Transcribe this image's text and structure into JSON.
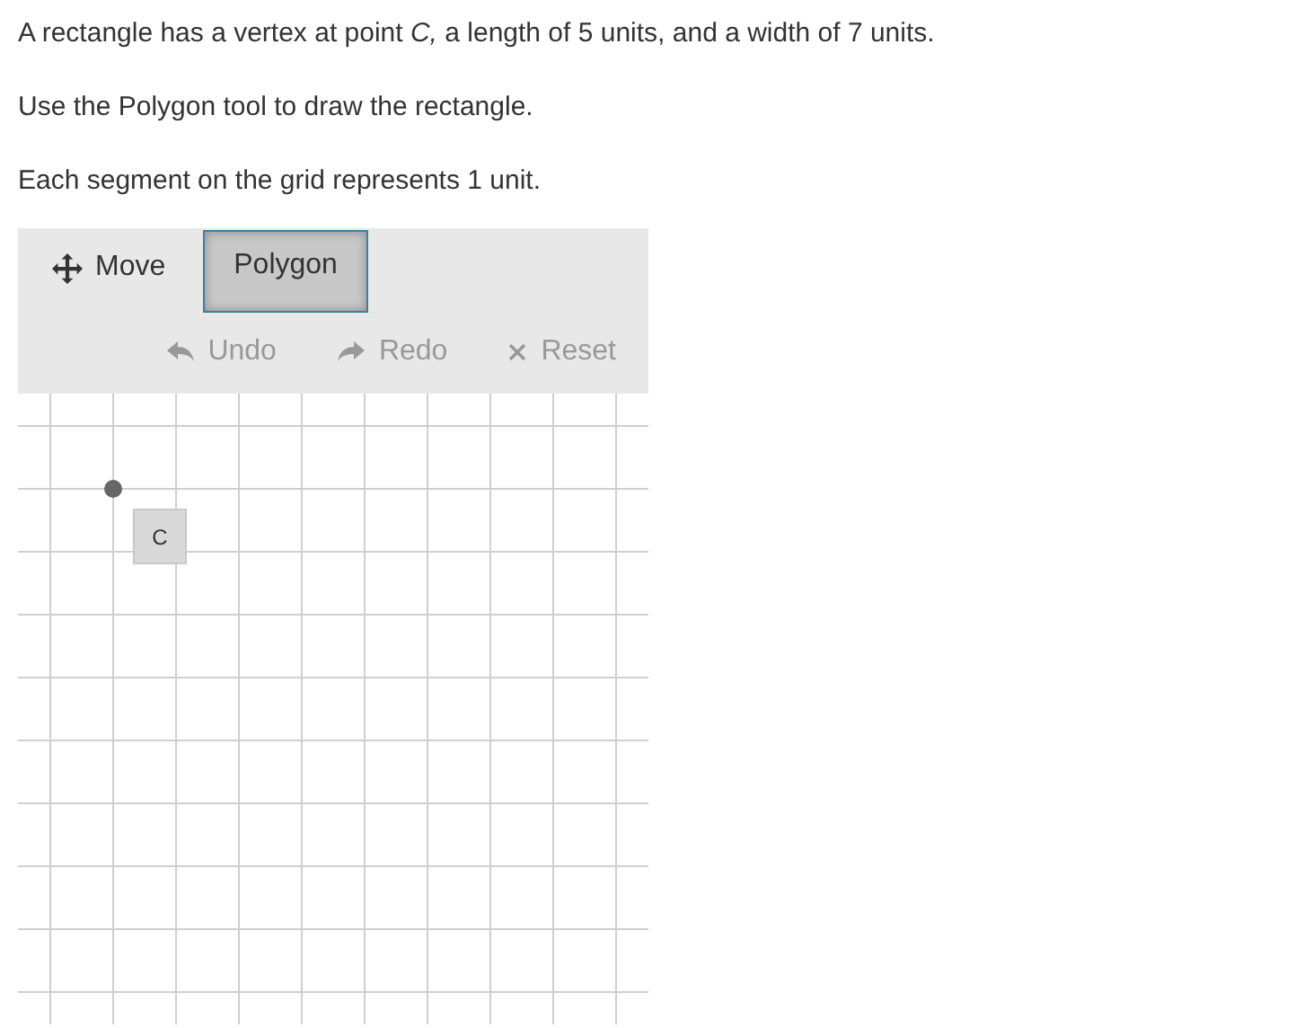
{
  "paragraphs": [
    "A rectangle has a vertex at point *C,* a length of 5 units, and a width of 7 units.",
    "Use the Polygon tool to draw the rectangle.",
    "Each segment on the grid represents 1 unit."
  ],
  "tools": [
    {
      "kind": "move",
      "label": "Move",
      "selected": false
    },
    {
      "kind": "polygon",
      "label": "Polygon",
      "selected": true
    }
  ],
  "actions": [
    {
      "kind": "undo",
      "label": "Undo",
      "disabled": true
    },
    {
      "kind": "redo",
      "label": "Redo",
      "disabled": true
    },
    {
      "kind": "reset",
      "label": "Reset",
      "disabled": true
    }
  ],
  "grid": {
    "point": {
      "label": "C"
    }
  }
}
